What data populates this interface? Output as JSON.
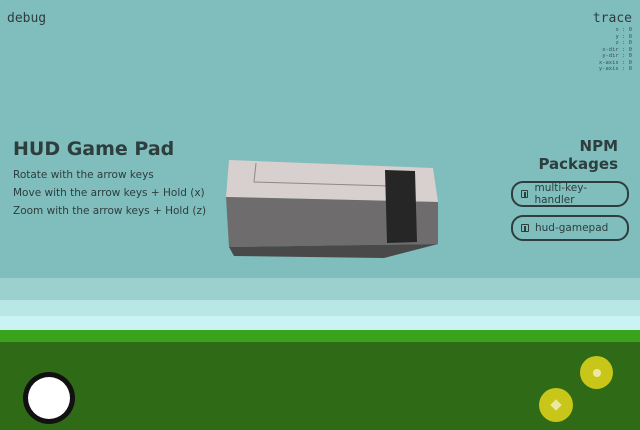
{
  "debug_label": "debug",
  "trace": {
    "title": "trace",
    "rows": [
      "x : 0",
      "y : 0",
      "z : 0",
      "x-dir : 0",
      "y-dir : 0",
      "x-axis : 0",
      "y-axis : 0"
    ]
  },
  "info": {
    "title": "HUD Game Pad",
    "lines": [
      "Rotate with the arrow keys",
      "Move with the arrow keys + Hold (x)",
      "Zoom with the arrow keys + Hold (z)"
    ]
  },
  "packages": {
    "title": "NPM Packages",
    "items": [
      {
        "label": "multi-key-handler",
        "icon": "npm-icon"
      },
      {
        "label": "hud-gamepad",
        "icon": "npm-icon"
      }
    ]
  },
  "controls": {
    "joystick": "joystick",
    "zoom_button_icon": "zoom-icon",
    "move_button_icon": "move-icon"
  },
  "colors": {
    "sky": "#80bdbd",
    "grass": "#2f6a17",
    "grass_edge": "#39a31b",
    "button": "#c9c61a",
    "text": "#2e3d3d"
  }
}
